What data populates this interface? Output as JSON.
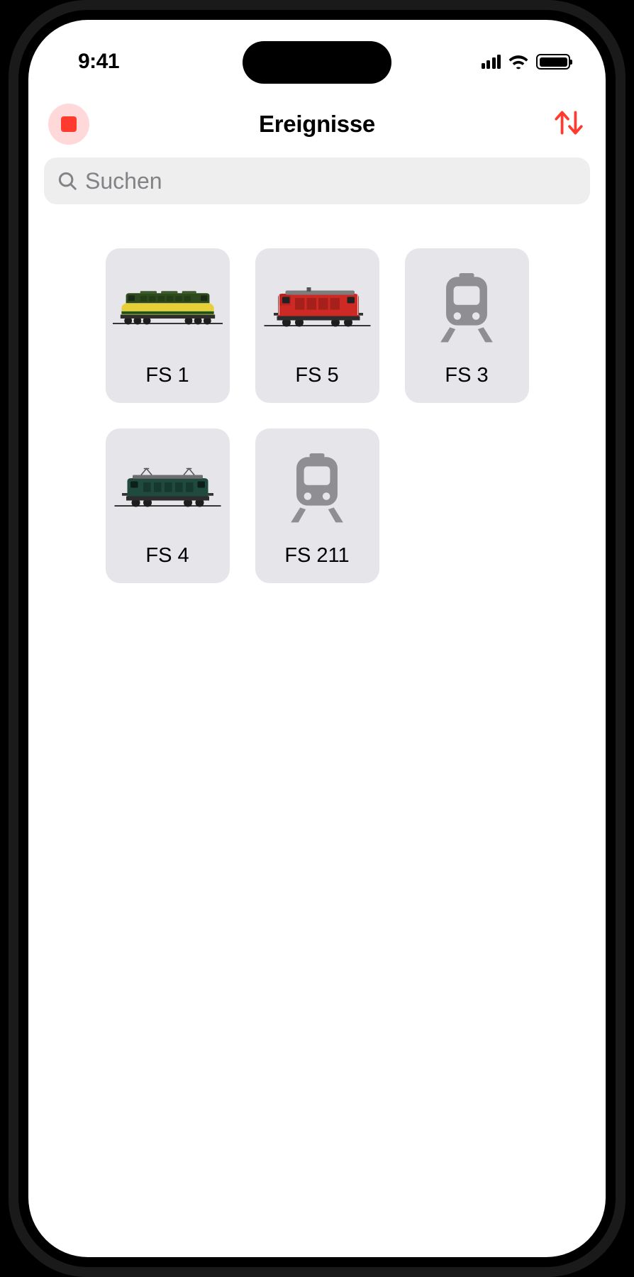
{
  "status": {
    "time": "9:41"
  },
  "header": {
    "title": "Ereignisse",
    "stop_icon": "stop-icon",
    "sort_icon": "sort-arrows-icon"
  },
  "search": {
    "placeholder": "Suchen",
    "icon": "search-icon"
  },
  "events": [
    {
      "label": "FS 1",
      "image": "locomotive-yellow-green",
      "icon_type": "custom"
    },
    {
      "label": "FS 5",
      "image": "locomotive-red",
      "icon_type": "custom"
    },
    {
      "label": "FS 3",
      "image": "tram-generic",
      "icon_type": "generic"
    },
    {
      "label": "FS 4",
      "image": "locomotive-green-electric",
      "icon_type": "custom"
    },
    {
      "label": "FS 211",
      "image": "tram-generic",
      "icon_type": "generic"
    }
  ],
  "colors": {
    "accent": "#ff3b30",
    "card_bg": "#e5e5ea",
    "search_bg": "#eeeeef",
    "placeholder": "#828287",
    "icon_gray": "#8e8e93"
  }
}
